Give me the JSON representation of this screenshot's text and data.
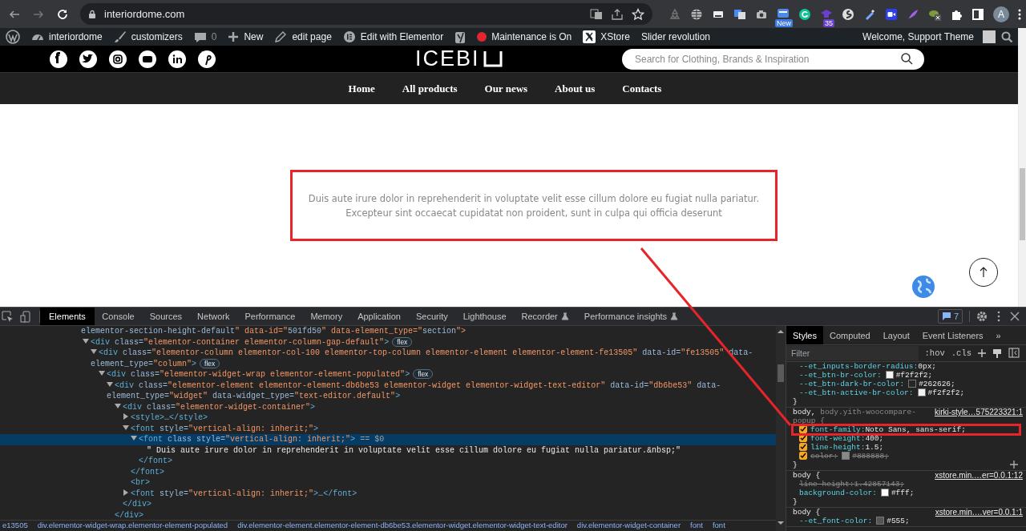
{
  "browser": {
    "url": "interiordome.com",
    "extension_badges": [
      "New",
      "35"
    ],
    "profile_initial": "A"
  },
  "admin_bar": {
    "items": [
      {
        "kind": "site",
        "label": "interiordome"
      },
      {
        "kind": "customize",
        "label": "customizers"
      },
      {
        "kind": "comments",
        "label": "0"
      },
      {
        "kind": "new",
        "label": "New"
      },
      {
        "kind": "edit",
        "label": "edit page"
      },
      {
        "kind": "elementor",
        "label": "Edit with Elementor"
      },
      {
        "kind": "seo"
      },
      {
        "kind": "maintenance",
        "label": "Maintenance is On",
        "color": "#e3262e"
      },
      {
        "kind": "xstore",
        "label": "XStore"
      },
      {
        "kind": "plain",
        "label": "Slider revolution"
      }
    ],
    "greeting": "Welcome, Support Theme"
  },
  "site_header": {
    "logo": "ICEBI",
    "search": {
      "placeholder": "Search for Clothing, Brands & Inspiration"
    }
  },
  "nav": [
    "Home",
    "All products",
    "Our news",
    "About us",
    "Contacts"
  ],
  "content": {
    "highlighted": true,
    "lines": [
      "Duis aute irure dolor in reprehenderit in voluptate velit esse cillum dolore eu fugiat nulla pariatur.",
      "Excepteur sint occaecat cupidatat non proident, sunt in culpa qui officia deserunt"
    ]
  },
  "devtools": {
    "tabs": [
      {
        "label": "Elements",
        "selected": true,
        "experimental": false
      },
      {
        "label": "Console",
        "selected": false,
        "experimental": false
      },
      {
        "label": "Sources",
        "selected": false,
        "experimental": false
      },
      {
        "label": "Network",
        "selected": false,
        "experimental": false
      },
      {
        "label": "Performance",
        "selected": false,
        "experimental": false
      },
      {
        "label": "Memory",
        "selected": false,
        "experimental": false
      },
      {
        "label": "Application",
        "selected": false,
        "experimental": false
      },
      {
        "label": "Security",
        "selected": false,
        "experimental": false
      },
      {
        "label": "Lighthouse",
        "selected": false,
        "experimental": false
      },
      {
        "label": "Recorder",
        "selected": false,
        "experimental": true
      },
      {
        "label": "Performance insights",
        "selected": false,
        "experimental": true
      }
    ],
    "issues_count": "7",
    "dom_fragment": "elementor-section-height-default\" data-id=\"501fd50\" data-element_type=\"section\">",
    "dom": [
      {
        "kind": "element",
        "text": "<div class=\"elementor-container elementor-column-gap-default\">",
        "badges": [
          "flex"
        ],
        "expanded": true,
        "selected": false,
        "children": [
          {
            "kind": "element",
            "text": "<div class=\"elementor-column elementor-col-100 elementor-top-column elementor-element elementor-element-fe13505\" data-id=\"fe13505\" data-element_type=\"column\">",
            "badges": [
              "flex"
            ],
            "expanded": true,
            "selected": false,
            "children": [
              {
                "kind": "element",
                "text": "<div class=\"elementor-widget-wrap elementor-element-populated\">",
                "badges": [
                  "flex"
                ],
                "expanded": true,
                "selected": false,
                "children": [
                  {
                    "kind": "element",
                    "text": "<div class=\"elementor-element elementor-element-db6be53 elementor-widget elementor-widget-text-editor\" data-id=\"db6be53\" data-element_type=\"widget\" data-widget_type=\"text-editor.default\">",
                    "expanded": true,
                    "selected": false,
                    "close": "</div>",
                    "children": [
                      {
                        "kind": "element",
                        "text": "<div class=\"elementor-widget-container\">",
                        "expanded": true,
                        "selected": false,
                        "close": "</div>",
                        "children": [
                          {
                            "kind": "element",
                            "text": "<style>…</style>",
                            "expanded": false,
                            "selected": false
                          },
                          {
                            "kind": "element",
                            "text": "<font style=\"vertical-align: inherit;\">",
                            "expanded": true,
                            "selected": false,
                            "close": "</font>",
                            "children": [
                              {
                                "kind": "element",
                                "text": "<font class style=\"vertical-align: inherit;\">",
                                "expanded": true,
                                "selected": true,
                                "suffix": "== $0",
                                "close": "</font>",
                                "children": [
                                  {
                                    "kind": "text",
                                    "text": "\" Duis aute irure dolor in reprehenderit in voluptate velit esse cillum dolore eu fugiat nulla pariatur.&nbsp;\"",
                                    "selected": false
                                  }
                                ]
                              }
                            ]
                          },
                          {
                            "kind": "element",
                            "text": "<br>",
                            "selected": false
                          },
                          {
                            "kind": "element",
                            "text": "<font style=\"vertical-align: inherit;\">…</font>",
                            "expanded": false,
                            "selected": false
                          }
                        ]
                      }
                    ]
                  }
                ]
              }
            ]
          }
        ]
      }
    ],
    "breadcrumbs": [
      "e13505",
      "div.elementor-widget-wrap.elementor-element-populated",
      "div.elementor-element.elementor-element-db6be53.elementor-widget.elementor-widget-text-editor",
      "div.elementor-widget-container",
      "font",
      "font"
    ],
    "styles": {
      "tabs": [
        {
          "label": "Styles",
          "selected": true
        },
        {
          "label": "Computed",
          "selected": false
        },
        {
          "label": "Layout",
          "selected": false
        },
        {
          "label": "Event Listeners",
          "selected": false
        }
      ],
      "more": "»",
      "filter_placeholder": "Filter",
      "hov": ":hov",
      "cls": ".cls",
      "rules": [
        {
          "declarations": [
            {
              "name": "--et_inputs-border-radius:",
              "value": "0px;",
              "overridden": false
            },
            {
              "name": "--et_btn-br-color:",
              "value": "#f2f2f2;",
              "swatch": true,
              "overridden": false
            },
            {
              "name": "--et_btn-dark-br-color:",
              "value": "#262626;",
              "swatch": true,
              "overridden": false
            },
            {
              "name": "--et_btn-active-br-color:",
              "value": "#f2f2f2;",
              "swatch": true,
              "overridden": false
            }
          ],
          "close": "}"
        },
        {
          "selector": "body,",
          "selector_dim": "body.yith-woocompare-popup {",
          "source": "kirki-style…575223321:1",
          "declarations": [
            {
              "name": "font-family:",
              "value": "Noto Sans, sans-serif;",
              "checked": true,
              "overridden": false,
              "highlighted": true
            },
            {
              "name": "font-weight:",
              "value": "400;",
              "checked": true,
              "overridden": false
            },
            {
              "name": "line-height:",
              "value": "1.5;",
              "checked": true,
              "overridden": false
            },
            {
              "name": "color:",
              "value": "#888888;",
              "swatch": true,
              "checked": true,
              "overridden": true
            }
          ],
          "close": "}"
        },
        {
          "selector": "body {",
          "source": "xstore.min.…er=0.0.1:12",
          "declarations": [
            {
              "name": "line-height:",
              "value": "1.42857143;",
              "overridden": true
            },
            {
              "name": "background-color:",
              "value": "#fff;",
              "swatch": true,
              "overridden": false
            }
          ],
          "close": "}"
        },
        {
          "selector": "body {",
          "source": "xstore.min.…ver=0.0.1:1",
          "declarations": [
            {
              "name": "--et_font-color:",
              "value": "#555;",
              "swatch": true,
              "overridden": false
            }
          ]
        }
      ]
    }
  }
}
